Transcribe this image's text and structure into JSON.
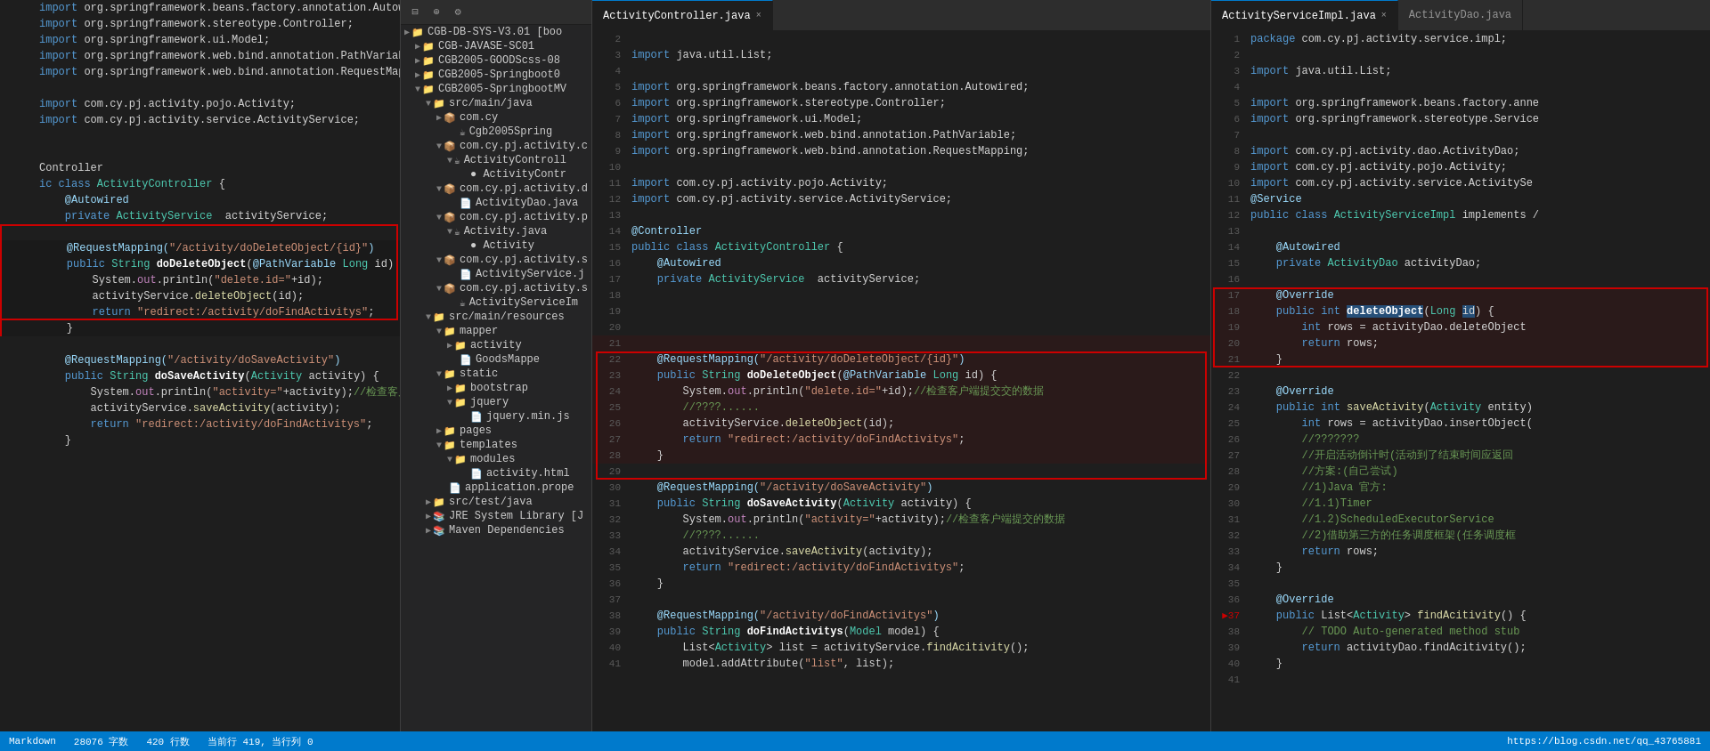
{
  "tabs": {
    "left_panel_tab": "ActivityController.java",
    "center_tab": "ActivityController.java",
    "center_tab_close": "×",
    "right_tab1": "ActivityServiceImpl.java",
    "right_tab1_close": "×",
    "right_tab2": "ActivityDao.java"
  },
  "status_bar": {
    "file_type": "Markdown",
    "word_count": "28076 字数",
    "line_count": "420 行数",
    "current": "当前行 419, 当行列 0",
    "website": "https://blog.csdn.net/qq_43765881"
  },
  "tree": {
    "toolbar_items": [
      "collapse",
      "locate",
      "settings"
    ],
    "items": [
      {
        "label": "CGB-DB-SYS-V3.01 [boo",
        "indent": 0,
        "icon": "📁",
        "arrow": "▶"
      },
      {
        "label": "CGB-JAVASE-SC01",
        "indent": 1,
        "icon": "📁",
        "arrow": "▶"
      },
      {
        "label": "CGB2005-GOODScss-08",
        "indent": 1,
        "icon": "📁",
        "arrow": "▶"
      },
      {
        "label": "CGB2005-Springboot0",
        "indent": 1,
        "icon": "📁",
        "arrow": "▶"
      },
      {
        "label": "CGB2005-SpringbootMV",
        "indent": 1,
        "icon": "📁",
        "arrow": "▼"
      },
      {
        "label": "src/main/java",
        "indent": 2,
        "icon": "📁",
        "arrow": "▼"
      },
      {
        "label": "com.cy",
        "indent": 3,
        "icon": "📦",
        "arrow": "▶"
      },
      {
        "label": "Cgb2005Spring",
        "indent": 4,
        "icon": "☕",
        "arrow": ""
      },
      {
        "label": "com.cy.pj.activity.c",
        "indent": 3,
        "icon": "📦",
        "arrow": "▼"
      },
      {
        "label": "ActivityControll",
        "indent": 4,
        "icon": "☕",
        "arrow": "▼"
      },
      {
        "label": "● ActivityContr",
        "indent": 5,
        "icon": "",
        "arrow": ""
      },
      {
        "label": "com.cy.pj.activity.d",
        "indent": 3,
        "icon": "📦",
        "arrow": "▼"
      },
      {
        "label": "ActivityDao.java",
        "indent": 4,
        "icon": "📄",
        "arrow": ""
      },
      {
        "label": "com.cy.pj.activity.p",
        "indent": 3,
        "icon": "📦",
        "arrow": "▼"
      },
      {
        "label": "Activity.java",
        "indent": 4,
        "icon": "☕",
        "arrow": "▼"
      },
      {
        "label": "● Activity",
        "indent": 5,
        "icon": "",
        "arrow": ""
      },
      {
        "label": "com.cy.pj.activity.s",
        "indent": 3,
        "icon": "📦",
        "arrow": "▼"
      },
      {
        "label": "ActivityService.j",
        "indent": 4,
        "icon": "📄",
        "arrow": ""
      },
      {
        "label": "com.cy.pj.activity.s",
        "indent": 3,
        "icon": "📦",
        "arrow": "▼"
      },
      {
        "label": "ActivityServiceIm",
        "indent": 4,
        "icon": "☕",
        "arrow": ""
      },
      {
        "label": "src/main/resources",
        "indent": 2,
        "icon": "📁",
        "arrow": "▼"
      },
      {
        "label": "mapper",
        "indent": 3,
        "icon": "📁",
        "arrow": "▼"
      },
      {
        "label": "activity",
        "indent": 4,
        "icon": "📁",
        "arrow": "▶"
      },
      {
        "label": "GoodsMappe",
        "indent": 4,
        "icon": "📄",
        "arrow": ""
      },
      {
        "label": "static",
        "indent": 3,
        "icon": "📁",
        "arrow": "▼"
      },
      {
        "label": "bootstrap",
        "indent": 4,
        "icon": "📁",
        "arrow": "▶"
      },
      {
        "label": "jquery",
        "indent": 4,
        "icon": "📁",
        "arrow": "▼"
      },
      {
        "label": "jquery.min.js",
        "indent": 5,
        "icon": "📄",
        "arrow": ""
      },
      {
        "label": "pages",
        "indent": 3,
        "icon": "📁",
        "arrow": "▶"
      },
      {
        "label": "templates",
        "indent": 3,
        "icon": "📁",
        "arrow": "▼"
      },
      {
        "label": "modules",
        "indent": 4,
        "icon": "📁",
        "arrow": "▼"
      },
      {
        "label": "activity.html",
        "indent": 5,
        "icon": "📄",
        "arrow": ""
      },
      {
        "label": "application.prope",
        "indent": 3,
        "icon": "📄",
        "arrow": ""
      },
      {
        "label": "src/test/java",
        "indent": 2,
        "icon": "📁",
        "arrow": "▶"
      },
      {
        "label": "JRE System Library [J",
        "indent": 2,
        "icon": "📚",
        "arrow": "▶"
      },
      {
        "label": "Maven Dependencies",
        "indent": 2,
        "icon": "📚",
        "arrow": "▶"
      }
    ]
  }
}
